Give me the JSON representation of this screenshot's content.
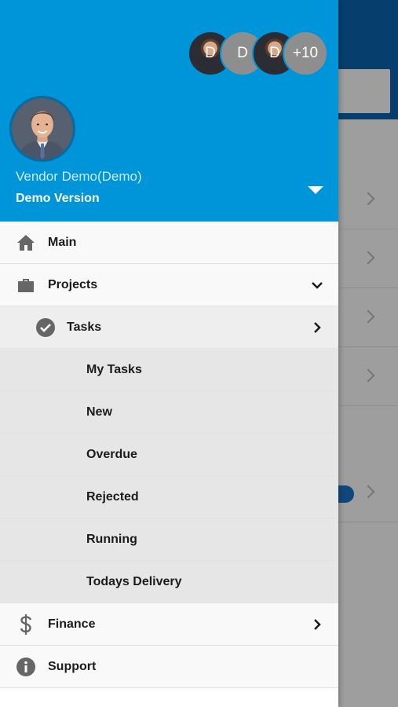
{
  "user": {
    "name": "Vendor Demo(Demo)",
    "subtitle": "Demo Version"
  },
  "team_avatars": [
    {
      "type": "photo",
      "initial": "D"
    },
    {
      "type": "initial",
      "initial": "D"
    },
    {
      "type": "photo",
      "initial": "D"
    },
    {
      "type": "more",
      "initial": "+10"
    }
  ],
  "menu": {
    "main": {
      "label": "Main",
      "icon": "home-icon"
    },
    "projects": {
      "label": "Projects",
      "icon": "briefcase-icon",
      "expanded": true
    },
    "tasks": {
      "label": "Tasks",
      "icon": "check-circle-icon"
    },
    "task_items": [
      "My Tasks",
      "New",
      "Overdue",
      "Rejected",
      "Running",
      "Todays Delivery"
    ],
    "finance": {
      "label": "Finance",
      "icon": "dollar-icon"
    },
    "support": {
      "label": "Support",
      "icon": "info-icon"
    }
  },
  "colors": {
    "header_bg": "#0094d9",
    "background_header": "#0b66b0",
    "text_primary": "#1b1b1b"
  }
}
